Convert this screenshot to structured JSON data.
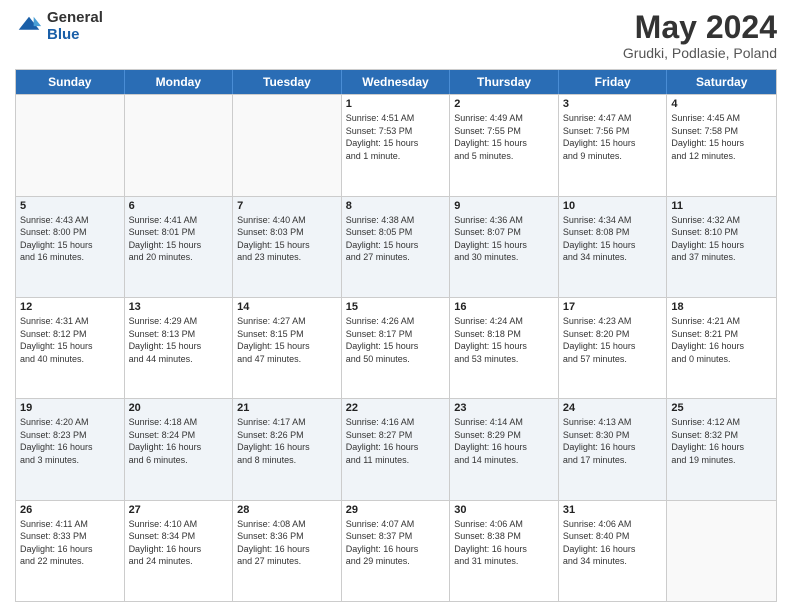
{
  "logo": {
    "general": "General",
    "blue": "Blue"
  },
  "title": {
    "month": "May 2024",
    "location": "Grudki, Podlasie, Poland"
  },
  "days": [
    "Sunday",
    "Monday",
    "Tuesday",
    "Wednesday",
    "Thursday",
    "Friday",
    "Saturday"
  ],
  "weeks": [
    [
      {
        "day": "",
        "info": ""
      },
      {
        "day": "",
        "info": ""
      },
      {
        "day": "",
        "info": ""
      },
      {
        "day": "1",
        "info": "Sunrise: 4:51 AM\nSunset: 7:53 PM\nDaylight: 15 hours\nand 1 minute."
      },
      {
        "day": "2",
        "info": "Sunrise: 4:49 AM\nSunset: 7:55 PM\nDaylight: 15 hours\nand 5 minutes."
      },
      {
        "day": "3",
        "info": "Sunrise: 4:47 AM\nSunset: 7:56 PM\nDaylight: 15 hours\nand 9 minutes."
      },
      {
        "day": "4",
        "info": "Sunrise: 4:45 AM\nSunset: 7:58 PM\nDaylight: 15 hours\nand 12 minutes."
      }
    ],
    [
      {
        "day": "5",
        "info": "Sunrise: 4:43 AM\nSunset: 8:00 PM\nDaylight: 15 hours\nand 16 minutes."
      },
      {
        "day": "6",
        "info": "Sunrise: 4:41 AM\nSunset: 8:01 PM\nDaylight: 15 hours\nand 20 minutes."
      },
      {
        "day": "7",
        "info": "Sunrise: 4:40 AM\nSunset: 8:03 PM\nDaylight: 15 hours\nand 23 minutes."
      },
      {
        "day": "8",
        "info": "Sunrise: 4:38 AM\nSunset: 8:05 PM\nDaylight: 15 hours\nand 27 minutes."
      },
      {
        "day": "9",
        "info": "Sunrise: 4:36 AM\nSunset: 8:07 PM\nDaylight: 15 hours\nand 30 minutes."
      },
      {
        "day": "10",
        "info": "Sunrise: 4:34 AM\nSunset: 8:08 PM\nDaylight: 15 hours\nand 34 minutes."
      },
      {
        "day": "11",
        "info": "Sunrise: 4:32 AM\nSunset: 8:10 PM\nDaylight: 15 hours\nand 37 minutes."
      }
    ],
    [
      {
        "day": "12",
        "info": "Sunrise: 4:31 AM\nSunset: 8:12 PM\nDaylight: 15 hours\nand 40 minutes."
      },
      {
        "day": "13",
        "info": "Sunrise: 4:29 AM\nSunset: 8:13 PM\nDaylight: 15 hours\nand 44 minutes."
      },
      {
        "day": "14",
        "info": "Sunrise: 4:27 AM\nSunset: 8:15 PM\nDaylight: 15 hours\nand 47 minutes."
      },
      {
        "day": "15",
        "info": "Sunrise: 4:26 AM\nSunset: 8:17 PM\nDaylight: 15 hours\nand 50 minutes."
      },
      {
        "day": "16",
        "info": "Sunrise: 4:24 AM\nSunset: 8:18 PM\nDaylight: 15 hours\nand 53 minutes."
      },
      {
        "day": "17",
        "info": "Sunrise: 4:23 AM\nSunset: 8:20 PM\nDaylight: 15 hours\nand 57 minutes."
      },
      {
        "day": "18",
        "info": "Sunrise: 4:21 AM\nSunset: 8:21 PM\nDaylight: 16 hours\nand 0 minutes."
      }
    ],
    [
      {
        "day": "19",
        "info": "Sunrise: 4:20 AM\nSunset: 8:23 PM\nDaylight: 16 hours\nand 3 minutes."
      },
      {
        "day": "20",
        "info": "Sunrise: 4:18 AM\nSunset: 8:24 PM\nDaylight: 16 hours\nand 6 minutes."
      },
      {
        "day": "21",
        "info": "Sunrise: 4:17 AM\nSunset: 8:26 PM\nDaylight: 16 hours\nand 8 minutes."
      },
      {
        "day": "22",
        "info": "Sunrise: 4:16 AM\nSunset: 8:27 PM\nDaylight: 16 hours\nand 11 minutes."
      },
      {
        "day": "23",
        "info": "Sunrise: 4:14 AM\nSunset: 8:29 PM\nDaylight: 16 hours\nand 14 minutes."
      },
      {
        "day": "24",
        "info": "Sunrise: 4:13 AM\nSunset: 8:30 PM\nDaylight: 16 hours\nand 17 minutes."
      },
      {
        "day": "25",
        "info": "Sunrise: 4:12 AM\nSunset: 8:32 PM\nDaylight: 16 hours\nand 19 minutes."
      }
    ],
    [
      {
        "day": "26",
        "info": "Sunrise: 4:11 AM\nSunset: 8:33 PM\nDaylight: 16 hours\nand 22 minutes."
      },
      {
        "day": "27",
        "info": "Sunrise: 4:10 AM\nSunset: 8:34 PM\nDaylight: 16 hours\nand 24 minutes."
      },
      {
        "day": "28",
        "info": "Sunrise: 4:08 AM\nSunset: 8:36 PM\nDaylight: 16 hours\nand 27 minutes."
      },
      {
        "day": "29",
        "info": "Sunrise: 4:07 AM\nSunset: 8:37 PM\nDaylight: 16 hours\nand 29 minutes."
      },
      {
        "day": "30",
        "info": "Sunrise: 4:06 AM\nSunset: 8:38 PM\nDaylight: 16 hours\nand 31 minutes."
      },
      {
        "day": "31",
        "info": "Sunrise: 4:06 AM\nSunset: 8:40 PM\nDaylight: 16 hours\nand 34 minutes."
      },
      {
        "day": "",
        "info": ""
      }
    ]
  ]
}
